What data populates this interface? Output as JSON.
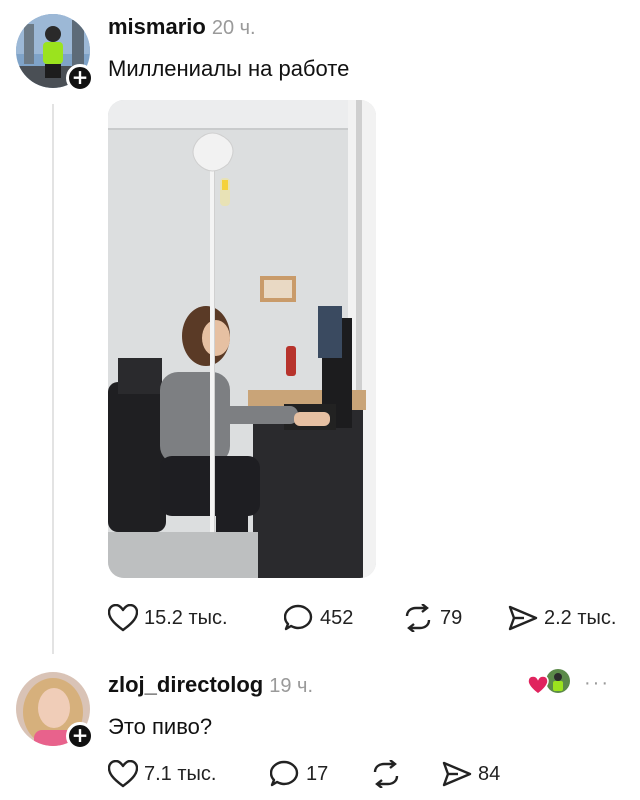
{
  "post": {
    "username": "mismario",
    "time": "20 ч.",
    "text": "Миллениалы на работе",
    "stats": {
      "likes": "15.2 тыс.",
      "comments": "452",
      "reposts": "79",
      "shares": "2.2 тыс."
    }
  },
  "reply": {
    "username": "zloj_directolog",
    "time": "19 ч.",
    "text": "Это пиво?",
    "more": "···",
    "stats": {
      "likes": "7.1 тыс.",
      "comments": "17",
      "reposts": "",
      "shares": "84"
    }
  },
  "colors": {
    "like_heart": "#e0245e",
    "text": "#111111",
    "muted": "#9a9a9a"
  },
  "icons": [
    "heart-icon",
    "comment-icon",
    "repost-icon",
    "share-icon",
    "plus-icon",
    "more-icon"
  ]
}
